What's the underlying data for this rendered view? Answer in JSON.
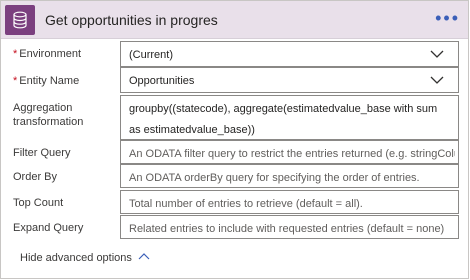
{
  "header": {
    "title": "Get opportunities in progres",
    "more_label": "•••",
    "icon": "database-icon",
    "accent": "#7b3f7f",
    "background": "#e9e0ea"
  },
  "fields": {
    "environment": {
      "required_mark": "*",
      "label": "Environment",
      "value": "(Current)"
    },
    "entity_name": {
      "required_mark": "*",
      "label": "Entity Name",
      "value": "Opportunities"
    },
    "aggregation": {
      "label": "Aggregation transformation",
      "value": "groupby((statecode), aggregate(estimatedvalue_base with sum as estimatedvalue_base))"
    },
    "filter_query": {
      "label": "Filter Query",
      "placeholder": "An ODATA filter query to restrict the entries returned (e.g. stringColumn eq 'st"
    },
    "order_by": {
      "label": "Order By",
      "placeholder": "An ODATA orderBy query for specifying the order of entries."
    },
    "top_count": {
      "label": "Top Count",
      "placeholder": "Total number of entries to retrieve (default = all)."
    },
    "expand_query": {
      "label": "Expand Query",
      "placeholder": "Related entries to include with requested entries (default = none)"
    }
  },
  "footer": {
    "label": "Hide advanced options",
    "icon": "chevron-up-icon"
  }
}
